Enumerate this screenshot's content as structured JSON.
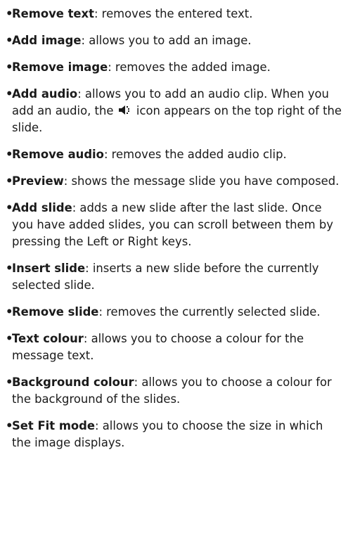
{
  "bullet_symbol": "•",
  "items": [
    {
      "term": "Remove text",
      "desc": ": removes the entered text."
    },
    {
      "term": "Add image",
      "desc": ": allows you to add an image."
    },
    {
      "term": "Remove image",
      "desc": ": removes the added image."
    },
    {
      "term": "Add audio",
      "desc": ": allows you to add an audio clip. When you add an audio, the",
      "icon": "speaker-icon",
      "desc_after": "icon appears on the top right of the slide."
    },
    {
      "term": "Remove audio",
      "desc": ": removes the added audio clip."
    },
    {
      "term": "Preview",
      "desc": ": shows the message slide you have composed."
    },
    {
      "term": "Add slide",
      "desc": ": adds a new slide after the last slide. Once you have added slides, you can scroll between them by pressing the Left or Right keys."
    },
    {
      "term": "Insert slide",
      "desc": ": inserts a new slide before the currently selected slide."
    },
    {
      "term": "Remove slide",
      "desc": ": removes the currently selected slide."
    },
    {
      "term": "Text colour",
      "desc": ": allows you to choose a colour for the message text."
    },
    {
      "term": "Background colour",
      "desc": ": allows you to choose a colour for the background of the slides."
    },
    {
      "term": "Set Fit mode",
      "desc": ": allows you to choose the size in which the image displays."
    }
  ]
}
